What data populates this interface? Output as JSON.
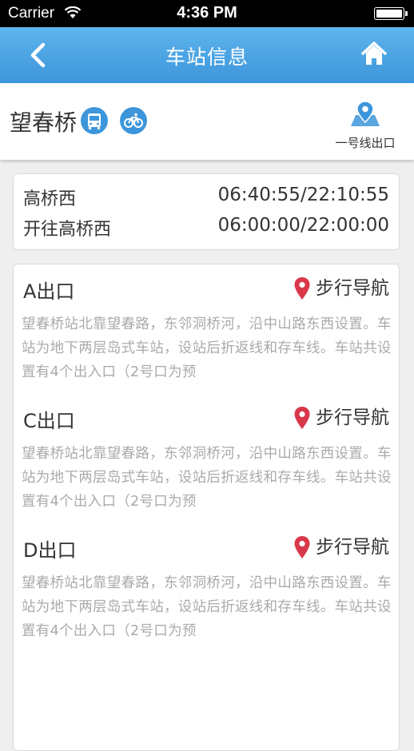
{
  "status_bar": {
    "carrier": "Carrier",
    "time": "4:36 PM"
  },
  "nav": {
    "title": "车站信息",
    "back_icon": "chevron-left-icon",
    "home_icon": "home-icon"
  },
  "station": {
    "name": "望春桥",
    "bus_icon": "bus-icon",
    "bike_icon": "bicycle-icon",
    "exit_link_label": "一号线出口",
    "exit_link_icon": "map-pin-icon"
  },
  "schedule": [
    {
      "direction": "高桥西",
      "times": "06:40:55/22:10:55"
    },
    {
      "direction": "开往高桥西",
      "times": "06:00:00/22:00:00"
    }
  ],
  "exits": [
    {
      "name": "A出口",
      "nav_label": "步行导航",
      "description": "望春桥站北靠望春路，东邻洞桥河，沿中山路东西设置。车站为地下两层岛式车站，设站后折返线和存车线。车站共设置有4个出入口（2号口为预"
    },
    {
      "name": "C出口",
      "nav_label": "步行导航",
      "description": "望春桥站北靠望春路，东邻洞桥河，沿中山路东西设置。车站为地下两层岛式车站，设站后折返线和存车线。车站共设置有4个出入口（2号口为预"
    },
    {
      "name": "D出口",
      "nav_label": "步行导航",
      "description": "望春桥站北靠望春路，东邻洞桥河，沿中山路东西设置。车站为地下两层岛式车站，设站后折返线和存车线。车站共设置有4个出入口（2号口为预"
    }
  ],
  "colors": {
    "accent": "#3d96db",
    "pin": "#d9384a"
  }
}
